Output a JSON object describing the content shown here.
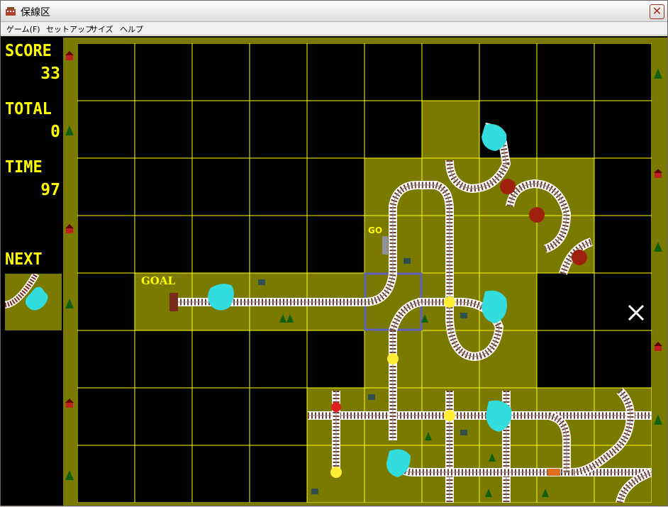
{
  "window": {
    "title": "保線区"
  },
  "menu": {
    "items": [
      "ゲーム(F)",
      "セットアップ",
      "サイズ",
      "ヘルプ"
    ]
  },
  "panel": {
    "score_label": "SCORE",
    "score_value": "33",
    "total_label": "TOTAL",
    "total_value": "0",
    "time_label": "TIME",
    "time_value": "97",
    "next_label": "NEXT"
  },
  "board": {
    "cols": 10,
    "rows": 8,
    "goal_text": "GOAL",
    "go_text": "GO",
    "colors": {
      "grass": "#7a7a00",
      "grid": "#ffff00",
      "empty": "#000000",
      "track_bed": "#ffffff",
      "rail": "#6a3a2a",
      "water": "#33dddd",
      "cursor": "#6060c0"
    },
    "filled_cells": [
      [
        1,
        6
      ],
      [
        2,
        5
      ],
      [
        2,
        6
      ],
      [
        2,
        7
      ],
      [
        2,
        8
      ],
      [
        3,
        5
      ],
      [
        3,
        6
      ],
      [
        3,
        7
      ],
      [
        3,
        8
      ],
      [
        4,
        1
      ],
      [
        4,
        2
      ],
      [
        4,
        3
      ],
      [
        4,
        4
      ],
      [
        4,
        5
      ],
      [
        4,
        6
      ],
      [
        4,
        7
      ],
      [
        5,
        5
      ],
      [
        5,
        6
      ],
      [
        5,
        7
      ],
      [
        6,
        4
      ],
      [
        6,
        5
      ],
      [
        6,
        6
      ],
      [
        6,
        7
      ],
      [
        6,
        8
      ],
      [
        6,
        9
      ],
      [
        7,
        4
      ],
      [
        7,
        5
      ],
      [
        7,
        6
      ],
      [
        7,
        7
      ],
      [
        7,
        8
      ],
      [
        7,
        9
      ]
    ],
    "cursor_cell": [
      4,
      5
    ]
  }
}
